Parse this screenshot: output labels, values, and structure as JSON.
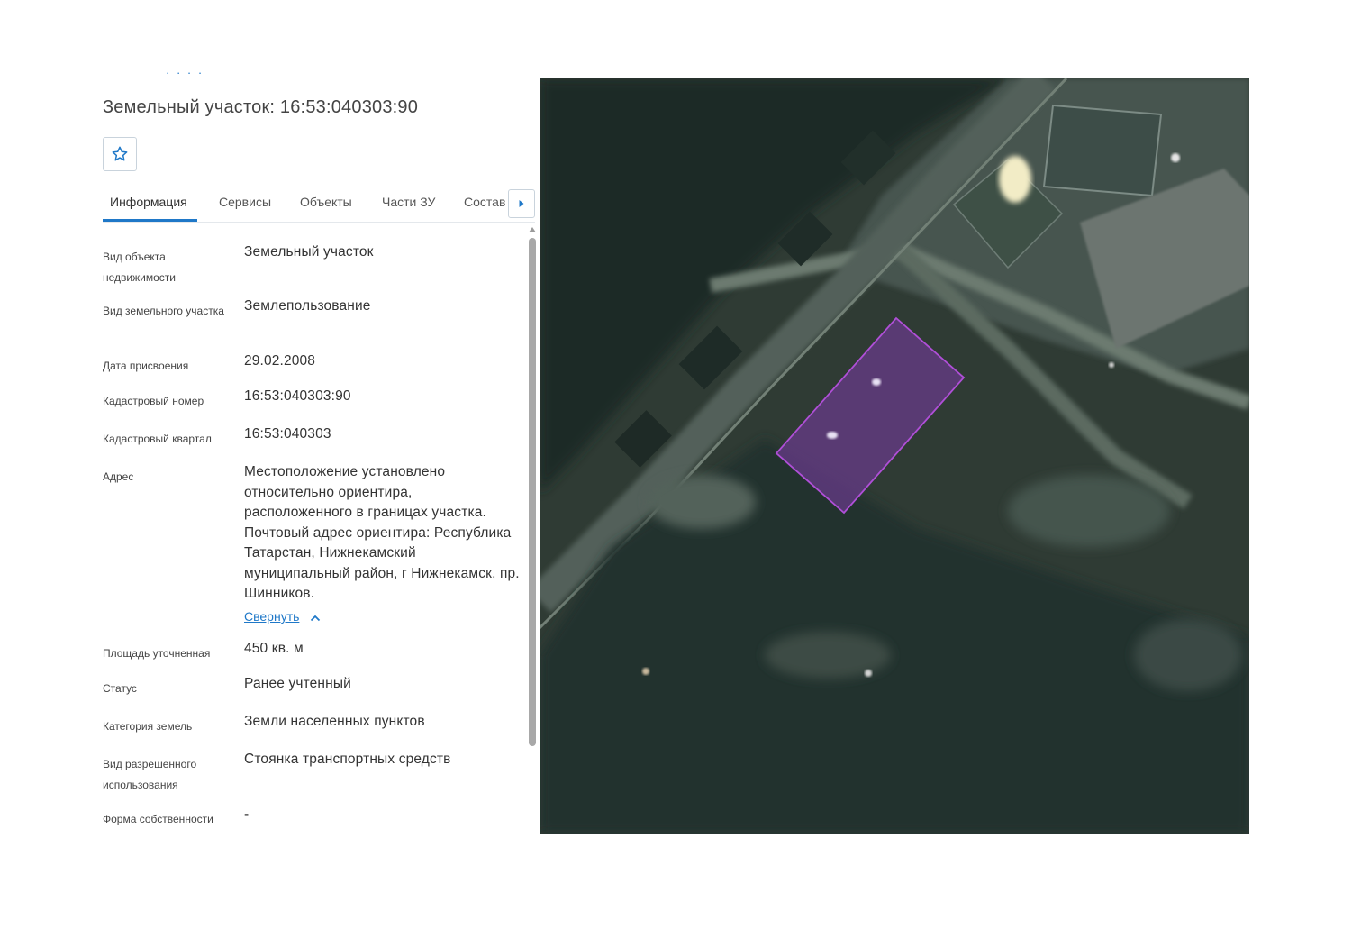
{
  "header": {
    "cutoff_link": "· · · ·",
    "title": "Земельный участок: 16:53:040303:90",
    "favorite_icon": "star-outline-icon"
  },
  "tabs": {
    "items": [
      {
        "label": "Информация",
        "active": true
      },
      {
        "label": "Сервисы",
        "active": false
      },
      {
        "label": "Объекты",
        "active": false
      },
      {
        "label": "Части ЗУ",
        "active": false
      },
      {
        "label": "Состав",
        "active": false
      }
    ],
    "next_icon": "caret-right-icon"
  },
  "properties": [
    {
      "label": "Вид объекта недвижимости",
      "value": "Земельный участок"
    },
    {
      "label": "Вид земельного участка",
      "value": "Землепользование"
    },
    {
      "label": "Дата присвоения",
      "value": "29.02.2008"
    },
    {
      "label": "Кадастровый номер",
      "value": "16:53:040303:90"
    },
    {
      "label": "Кадастровый квартал",
      "value": "16:53:040303"
    },
    {
      "label": "Адрес",
      "value": "Местоположение установлено относительно ориентира, расположенного в границах участка. Почтовый адрес ориентира: Республика Татарстан, Нижнекамский муниципальный район, г Нижнекамск, пр. Шинников."
    },
    {
      "label": "Площадь уточненная",
      "value": "450 кв. м"
    },
    {
      "label": "Статус",
      "value": "Ранее учтенный"
    },
    {
      "label": "Категория земель",
      "value": "Земли населенных пунктов"
    },
    {
      "label": "Вид разрешенного использования",
      "value": "Стоянка транспортных средств"
    },
    {
      "label": "Форма собственности",
      "value": "-"
    }
  ],
  "address_collapse_label": "Свернуть",
  "colors": {
    "accent": "#1f78c8",
    "parcel_fill": "#6a3a8c",
    "parcel_stroke": "#b04fd8"
  }
}
